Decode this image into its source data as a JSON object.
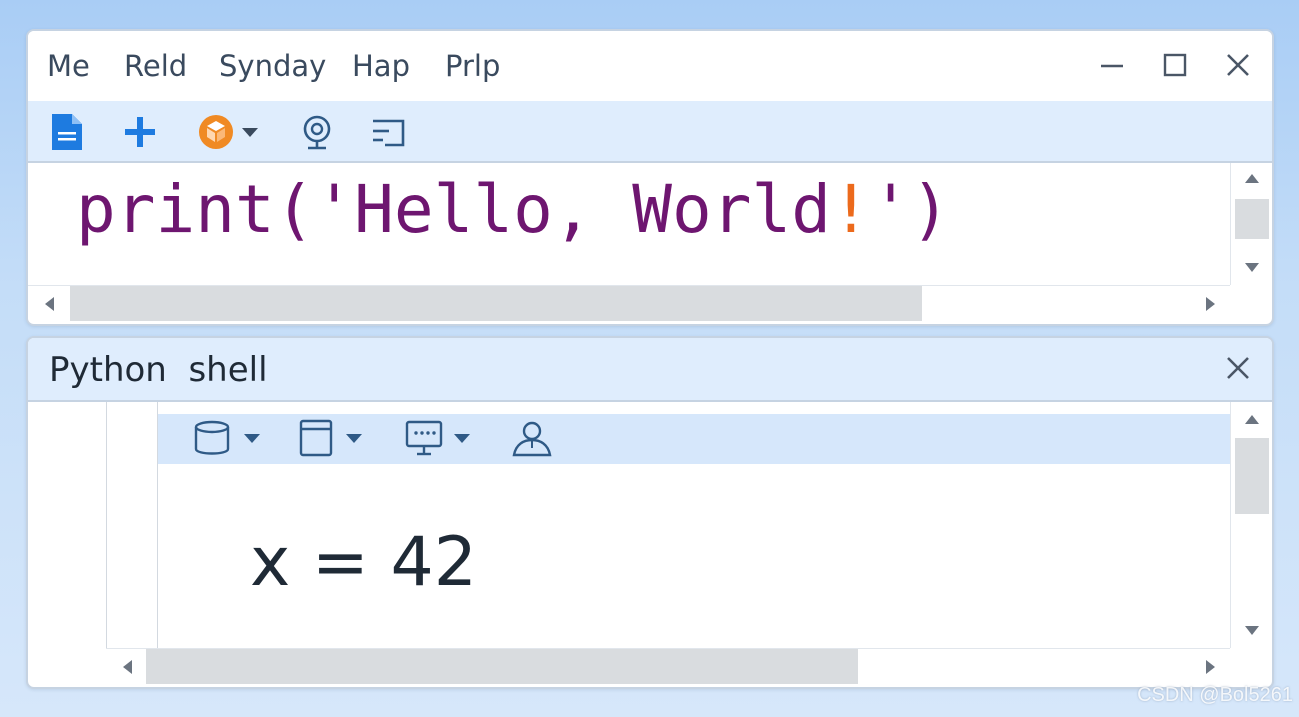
{
  "menu": {
    "items": [
      {
        "label": "Me"
      },
      {
        "label": "Reld"
      },
      {
        "label": "Synday"
      },
      {
        "label": "Hap"
      },
      {
        "label": "Prlp"
      }
    ]
  },
  "window_controls": {
    "icons": [
      "minimize-icon",
      "maximize-icon",
      "close-icon"
    ]
  },
  "editor_toolbar": {
    "icons": [
      "new-file-icon",
      "add-icon",
      "package-icon",
      "debug-icon",
      "step-icon"
    ]
  },
  "editor": {
    "code_parts": [
      "print('Hello, World",
      "!",
      "')"
    ],
    "colors": {
      "keyword": "#6e1670",
      "bang": "#ec6a1c"
    }
  },
  "shell": {
    "title": "Python  shell",
    "toolbar_icons": [
      "database-icon",
      "window-icon",
      "monitor-icon",
      "user-icon"
    ],
    "output": "x = 42"
  },
  "watermark": "CSDN @Bol5261",
  "colors": {
    "background": "#b9d6f7",
    "toolbar": "#dfedfd",
    "accent_blue": "#1e7be0",
    "accent_orange": "#f08a24"
  }
}
